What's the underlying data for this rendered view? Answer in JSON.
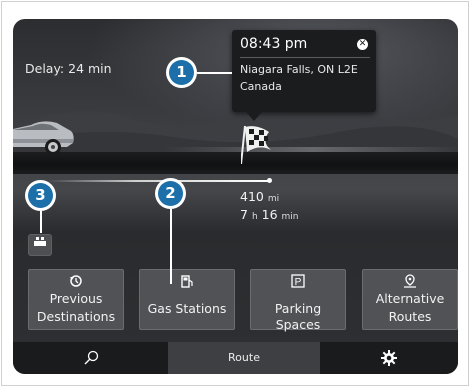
{
  "status": {
    "delay": "Delay: 24 min"
  },
  "destination_popup": {
    "time": "08:43 pm",
    "address": "Niagara Falls, ON L2E",
    "country": "Canada"
  },
  "trip": {
    "distance_value": "410",
    "distance_unit": "mi",
    "hours": "7",
    "hours_unit": "h",
    "minutes": "16",
    "minutes_unit": "min"
  },
  "quick_buttons": [
    {
      "line1": "Previous",
      "line2": "Destinations",
      "icon": "history-icon"
    },
    {
      "line1": "Gas Stations",
      "line2": "",
      "icon": "fuel-pump-icon"
    },
    {
      "line1": "Parking Spaces",
      "line2": "",
      "icon": "parking-icon"
    },
    {
      "line1": "Alternative",
      "line2": "Routes",
      "icon": "alternative-route-icon"
    }
  ],
  "bottom_bar": {
    "route_label": "Route"
  },
  "callouts": [
    "1",
    "2",
    "3"
  ],
  "colors": {
    "callout_blue": "#1c6fa8",
    "screen_dark": "#2c2d30"
  }
}
